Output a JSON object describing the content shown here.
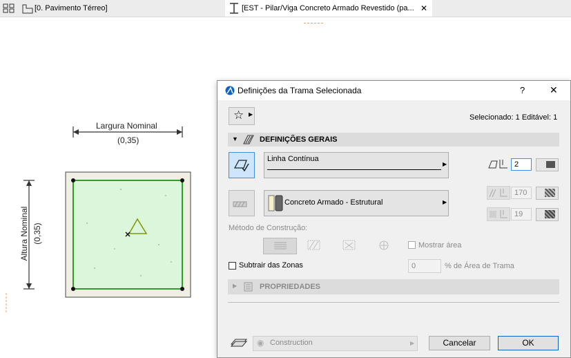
{
  "tabs": [
    {
      "label": "[0. Pavimento Térreo]"
    },
    {
      "label": "[EST - Pilar/Viga Concreto Armado Revestido (pa..."
    }
  ],
  "drawing": {
    "width_label": "Largura Nominal",
    "width_value": "(0,35)",
    "height_label": "Altura Nominal",
    "height_value": "(0,35)"
  },
  "dialog": {
    "title": "Definições da Trama Selecionada",
    "help": "?",
    "close": "✕",
    "selected_info": "Selecionado: 1 Editável: 1",
    "section_general": "DEFINIÇÕES GERAIS",
    "line_type": "Linha Contínua",
    "pen_value": "2",
    "material": "Concreto Armado - Estrutural",
    "pen_170": "170",
    "pen_19": "19",
    "construction_method_label": "Método de Construção:",
    "show_area": "Mostrar área",
    "subtract_zones": "Subtrair das Zonas",
    "area_percent_value": "0",
    "area_percent_label": "% de Área de Trama",
    "section_properties": "PROPRIEDADES",
    "layer": "Construction",
    "cancel": "Cancelar",
    "ok": "OK"
  },
  "colors": {
    "fill_green": "#dcf6dc",
    "border_green": "#2aa02a",
    "accent_blue": "#0a64c8",
    "tab_marker": "#f0a060"
  }
}
